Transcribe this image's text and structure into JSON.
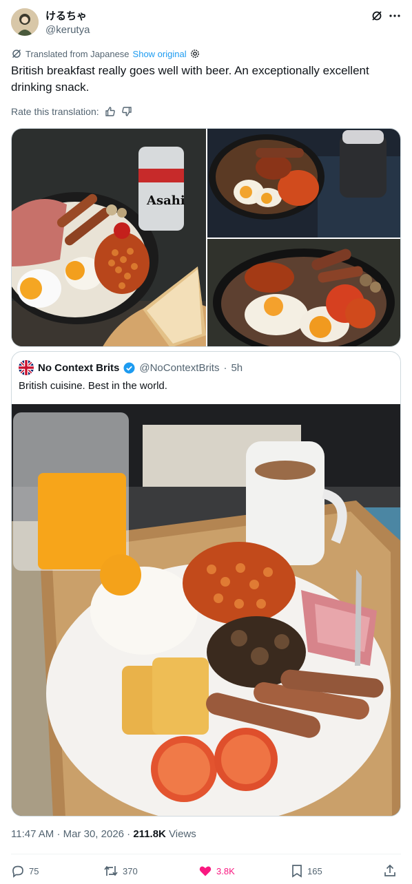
{
  "author": {
    "display_name": "けるちゃ",
    "handle": "@kerutya"
  },
  "translation": {
    "label": "Translated from Japanese",
    "show_original": "Show original"
  },
  "tweet_text": "British breakfast really goes well with beer. An exceptionally excellent drinking snack.",
  "rate": {
    "label": "Rate this translation:"
  },
  "quote": {
    "display_name": "No Context Brits",
    "handle": "@NoContextBrits",
    "separator": "·",
    "time": "5h",
    "text": "British cuisine. Best in the world."
  },
  "meta": {
    "time": "11:47 AM",
    "sep1": "·",
    "date": "Mar 30, 2026",
    "sep2": "·",
    "views_count": "211.8K",
    "views_label": "Views"
  },
  "actions": {
    "replies": "75",
    "reposts": "370",
    "likes": "3.8K",
    "bookmarks": "165"
  },
  "colors": {
    "accent": "#1d9bf0",
    "like": "#f91880",
    "muted": "#536471",
    "verified": "#1d9bf0"
  }
}
